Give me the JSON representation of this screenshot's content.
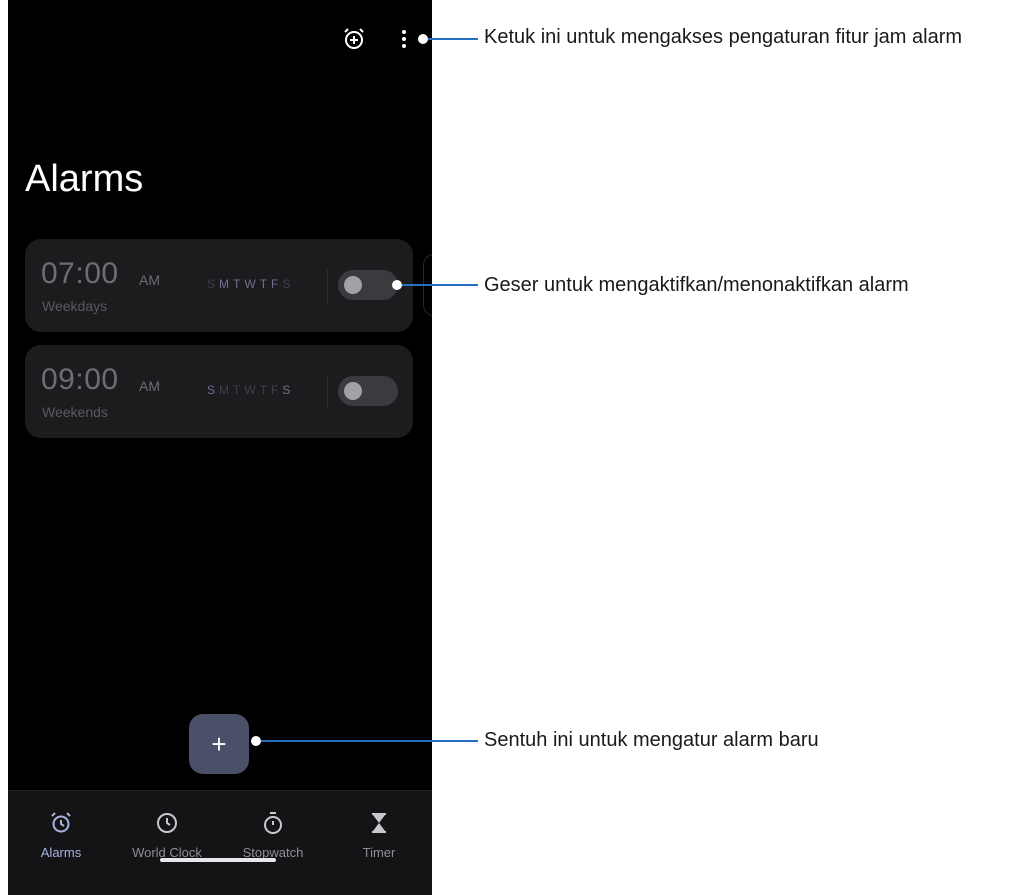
{
  "header": {
    "add_alarm_icon": "alarm-add-icon",
    "more_icon": "more-vertical-icon"
  },
  "page": {
    "title": "Alarms"
  },
  "alarms": [
    {
      "time": "07:00",
      "ampm": "AM",
      "label": "Weekdays",
      "days": [
        "S",
        "M",
        "T",
        "W",
        "T",
        "F",
        "S"
      ],
      "active_days": [
        false,
        true,
        true,
        true,
        true,
        true,
        false
      ],
      "enabled": false
    },
    {
      "time": "09:00",
      "ampm": "AM",
      "label": "Weekends",
      "days": [
        "S",
        "M",
        "T",
        "W",
        "T",
        "F",
        "S"
      ],
      "active_days": [
        true,
        false,
        false,
        false,
        false,
        false,
        true
      ],
      "enabled": false
    }
  ],
  "fab": {
    "label": "+"
  },
  "nav": {
    "items": [
      {
        "label": "Alarms",
        "icon": "alarm-clock-icon",
        "active": true
      },
      {
        "label": "World Clock",
        "icon": "clock-icon",
        "active": false
      },
      {
        "label": "Stopwatch",
        "icon": "stopwatch-icon",
        "active": false
      },
      {
        "label": "Timer",
        "icon": "hourglass-icon",
        "active": false
      }
    ]
  },
  "callouts": {
    "settings": "Ketuk ini untuk mengakses pengaturan fitur jam alarm",
    "toggle": "Geser untuk mengaktifkan/menonaktifkan alarm",
    "new_alarm": "Sentuh ini untuk mengatur alarm baru"
  },
  "colors": {
    "accent": "#a9b1e0",
    "callout_line": "#2a6ec2",
    "fab": "#4a5067",
    "card": "#1c1c1e"
  }
}
